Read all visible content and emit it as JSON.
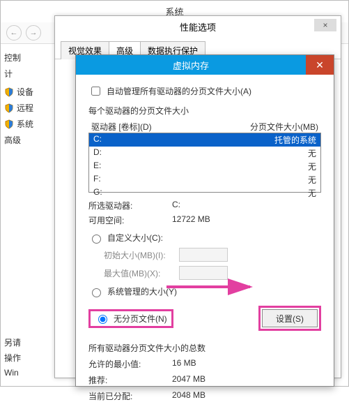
{
  "bg": {
    "title": "系统",
    "control": "控制",
    "compute": "计"
  },
  "left": {
    "items": [
      {
        "label": "设备"
      },
      {
        "label": "远程"
      },
      {
        "label": "系统"
      },
      {
        "label": "高级"
      }
    ]
  },
  "perf": {
    "title": "性能选项",
    "tabs": [
      "视觉效果",
      "高级",
      "数据执行保护"
    ],
    "close": "×"
  },
  "vm": {
    "title": "虚拟内存",
    "close": "✕",
    "auto_label": "自动管理所有驱动器的分页文件大小(A)",
    "section": "每个驱动器的分页文件大小",
    "head_drive": "驱动器 [卷标](D)",
    "head_size": "分页文件大小(MB)",
    "drives": [
      {
        "d": "C:",
        "v": "托管的系统",
        "sel": true
      },
      {
        "d": "D:",
        "v": "无"
      },
      {
        "d": "E:",
        "v": "无"
      },
      {
        "d": "F:",
        "v": "无"
      },
      {
        "d": "G:",
        "v": "无"
      }
    ],
    "selected_drive_label": "所选驱动器:",
    "selected_drive": "C:",
    "free_label": "可用空间:",
    "free": "12722 MB",
    "radio_custom": "自定义大小(C):",
    "initial_label": "初始大小(MB)(I):",
    "max_label": "最大值(MB)(X):",
    "radio_system": "系统管理的大小(Y)",
    "radio_none": "无分页文件(N)",
    "set_btn": "设置(S)",
    "totals_label": "所有驱动器分页文件大小的总数",
    "min_label": "允许的最小值:",
    "min": "16 MB",
    "rec_label": "推荐:",
    "rec": "2047 MB",
    "cur_label": "当前已分配:",
    "cur": "2048 MB"
  },
  "side": {
    "l1": "另请",
    "l2": "操作",
    "l3": "Win"
  }
}
